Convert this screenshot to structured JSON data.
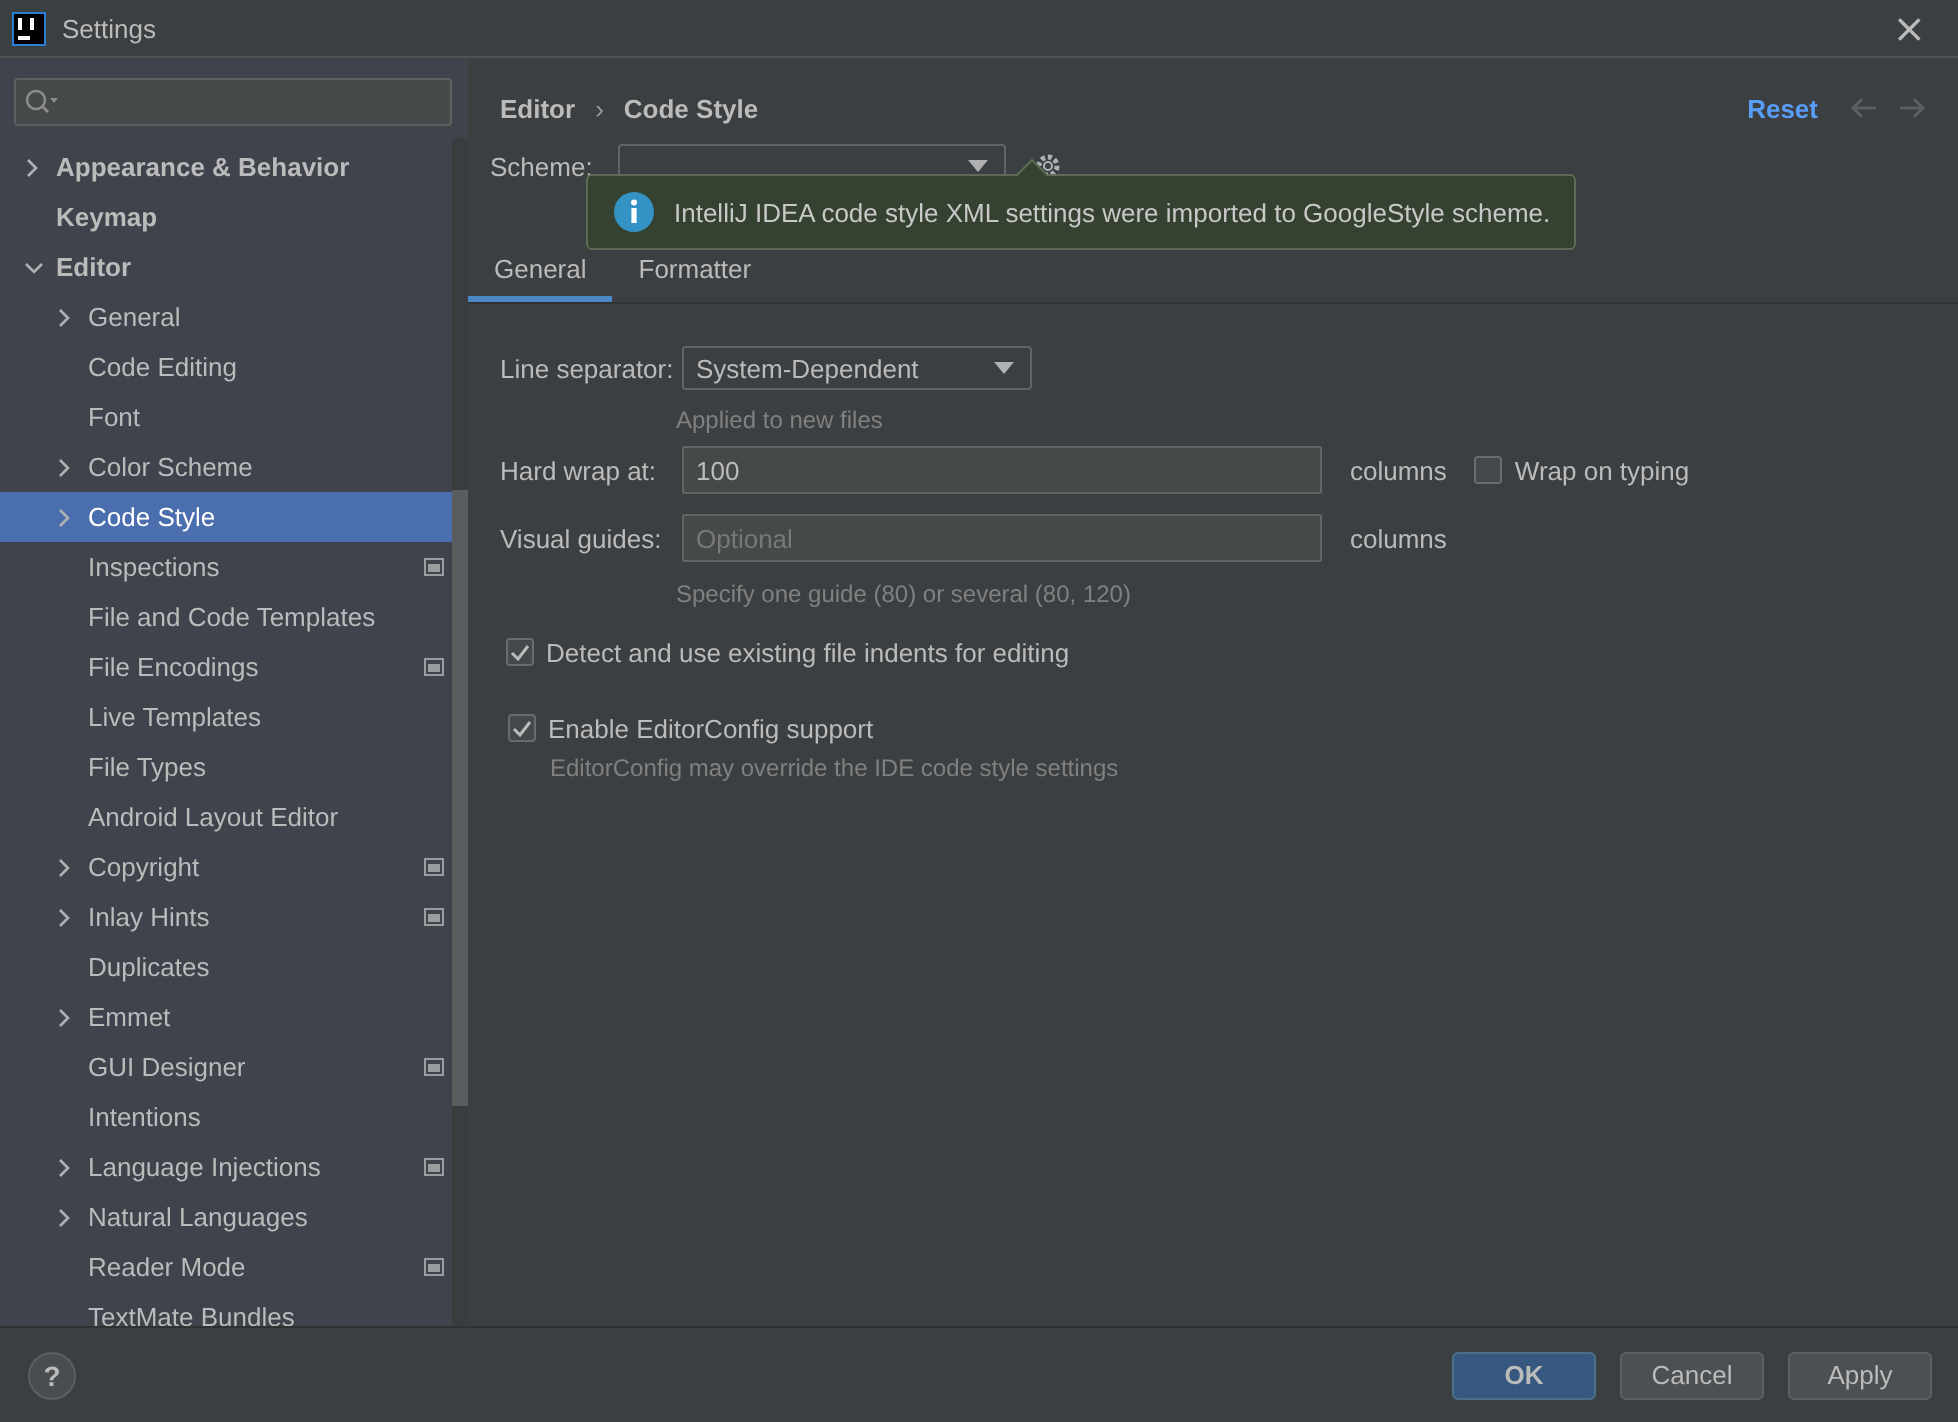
{
  "window": {
    "title": "Settings",
    "close": "×"
  },
  "sidebar": {
    "items": [
      {
        "label": "Appearance & Behavior",
        "kind": "group",
        "expanded": false,
        "selected": false,
        "project_scope": false
      },
      {
        "label": "Keymap",
        "kind": "leaf",
        "selected": false,
        "project_scope": false
      },
      {
        "label": "Editor",
        "kind": "group",
        "expanded": true,
        "selected": false,
        "project_scope": false,
        "children": [
          {
            "label": "General",
            "kind": "group",
            "expanded": false,
            "selected": false,
            "project_scope": false
          },
          {
            "label": "Code Editing",
            "kind": "leaf",
            "selected": false,
            "project_scope": false
          },
          {
            "label": "Font",
            "kind": "leaf",
            "selected": false,
            "project_scope": false
          },
          {
            "label": "Color Scheme",
            "kind": "group",
            "expanded": false,
            "selected": false,
            "project_scope": false
          },
          {
            "label": "Code Style",
            "kind": "group",
            "expanded": false,
            "selected": true,
            "project_scope": false
          },
          {
            "label": "Inspections",
            "kind": "leaf",
            "selected": false,
            "project_scope": true
          },
          {
            "label": "File and Code Templates",
            "kind": "leaf",
            "selected": false,
            "project_scope": false
          },
          {
            "label": "File Encodings",
            "kind": "leaf",
            "selected": false,
            "project_scope": true
          },
          {
            "label": "Live Templates",
            "kind": "leaf",
            "selected": false,
            "project_scope": false
          },
          {
            "label": "File Types",
            "kind": "leaf",
            "selected": false,
            "project_scope": false
          },
          {
            "label": "Android Layout Editor",
            "kind": "leaf",
            "selected": false,
            "project_scope": false
          },
          {
            "label": "Copyright",
            "kind": "group",
            "expanded": false,
            "selected": false,
            "project_scope": true
          },
          {
            "label": "Inlay Hints",
            "kind": "group",
            "expanded": false,
            "selected": false,
            "project_scope": true
          },
          {
            "label": "Duplicates",
            "kind": "leaf",
            "selected": false,
            "project_scope": false
          },
          {
            "label": "Emmet",
            "kind": "group",
            "expanded": false,
            "selected": false,
            "project_scope": false
          },
          {
            "label": "GUI Designer",
            "kind": "leaf",
            "selected": false,
            "project_scope": true
          },
          {
            "label": "Intentions",
            "kind": "leaf",
            "selected": false,
            "project_scope": false
          },
          {
            "label": "Language Injections",
            "kind": "group",
            "expanded": false,
            "selected": false,
            "project_scope": true
          },
          {
            "label": "Natural Languages",
            "kind": "group",
            "expanded": false,
            "selected": false,
            "project_scope": false
          },
          {
            "label": "Reader Mode",
            "kind": "leaf",
            "selected": false,
            "project_scope": true
          },
          {
            "label": "TextMate Bundles",
            "kind": "leaf",
            "selected": false,
            "project_scope": false
          }
        ]
      }
    ]
  },
  "breadcrumb": [
    {
      "label": "Editor"
    },
    {
      "label": "Code Style"
    }
  ],
  "breadcrumb_separator": "›",
  "reset": "Reset",
  "scheme": {
    "label": "Scheme:"
  },
  "notification": {
    "text": "IntelliJ IDEA code style XML settings were imported to GoogleStyle scheme."
  },
  "tabs": [
    {
      "label": "General",
      "selected": true
    },
    {
      "label": "Formatter",
      "selected": false
    }
  ],
  "line_separator": {
    "label": "Line separator:",
    "value": "System-Dependent",
    "hint": "Applied to new files"
  },
  "hard_wrap": {
    "label": "Hard wrap at:",
    "value": "100",
    "unit": "columns",
    "wrap_on_typing": {
      "label": "Wrap on typing",
      "checked": false
    }
  },
  "visual_guides": {
    "label": "Visual guides:",
    "placeholder": "Optional",
    "unit": "columns",
    "hint": "Specify one guide (80) or several (80, 120)"
  },
  "detect_indents": {
    "label": "Detect and use existing file indents for editing",
    "checked": true
  },
  "editorconfig": {
    "label": "Enable EditorConfig support",
    "checked": true,
    "hint": "EditorConfig may override the IDE code style settings"
  },
  "help": "?",
  "buttons": [
    {
      "label": "OK",
      "kind": "primary"
    },
    {
      "label": "Cancel",
      "kind": "normal"
    },
    {
      "label": "Apply",
      "kind": "normal"
    }
  ]
}
